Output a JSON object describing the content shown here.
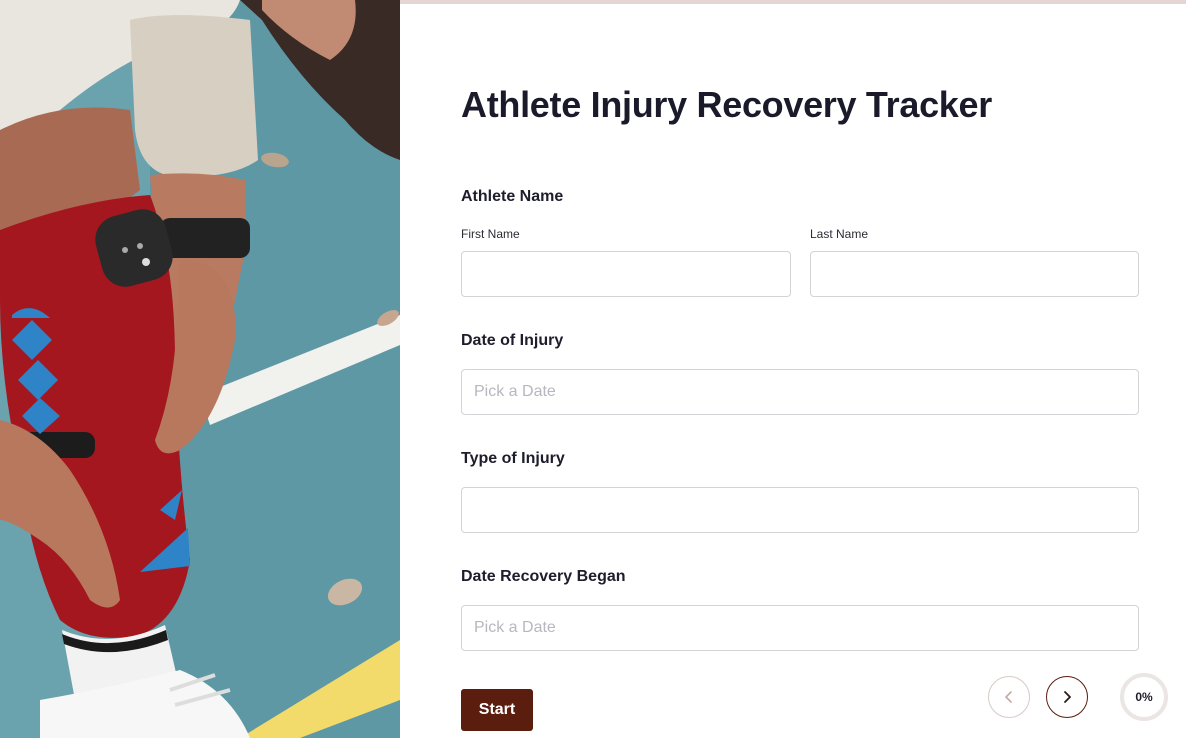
{
  "form": {
    "title": "Athlete Injury Recovery Tracker",
    "athlete_name": {
      "label": "Athlete Name",
      "first_name_label": "First Name",
      "first_name_value": "",
      "last_name_label": "Last Name",
      "last_name_value": ""
    },
    "date_of_injury": {
      "label": "Date of Injury",
      "placeholder": "Pick a Date",
      "value": ""
    },
    "type_of_injury": {
      "label": "Type of Injury",
      "value": ""
    },
    "date_recovery_began": {
      "label": "Date Recovery Began",
      "placeholder": "Pick a Date",
      "value": ""
    }
  },
  "footer": {
    "start_label": "Start",
    "prev_icon": "chevron-left-icon",
    "next_icon": "chevron-right-icon",
    "progress_text": "0%",
    "progress_value": 0
  },
  "colors": {
    "accent": "#5a1d0e",
    "input_border": "#d3d3d8",
    "top_bar": "#e6d6d3",
    "placeholder": "#b7b7bf"
  }
}
